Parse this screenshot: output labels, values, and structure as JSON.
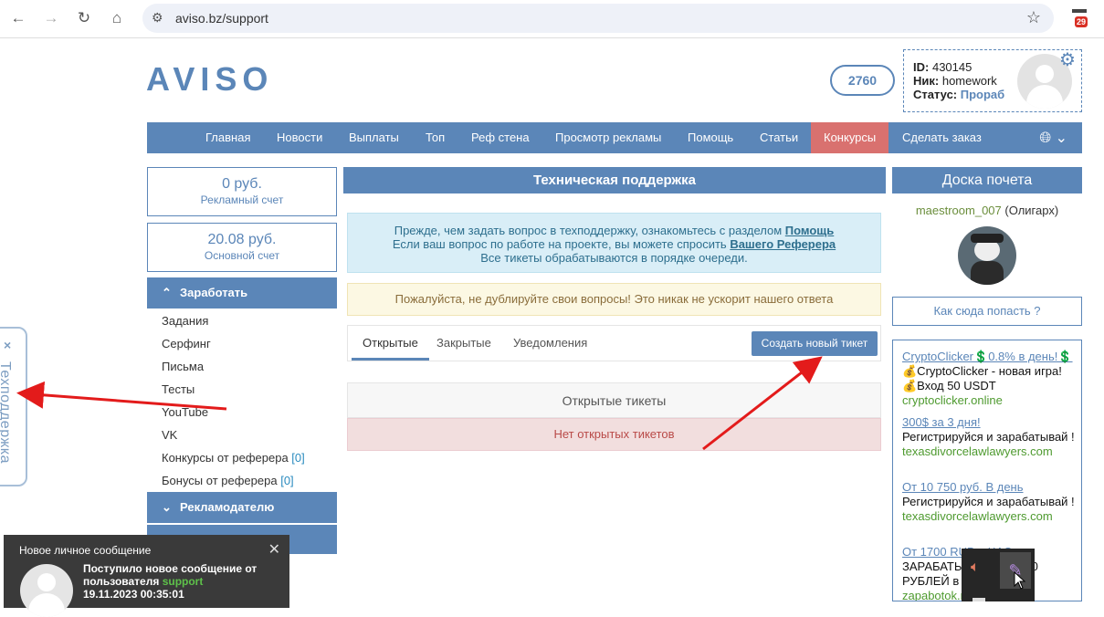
{
  "browser": {
    "url": "aviso.bz/support",
    "icons": [
      "back-icon",
      "forward-icon",
      "reload-icon",
      "home-icon",
      "site-settings-icon",
      "bookmark-star-icon",
      "calendar-extension-icon"
    ],
    "extension_badge": "29"
  },
  "header": {
    "logo": "AVISO",
    "balance_pill": "2760",
    "user": {
      "id_label": "ID:",
      "id_value": "430145",
      "nick_label": "Ник:",
      "nick_value": "homework",
      "status_label": "Статус:",
      "status_value": "Прораб"
    }
  },
  "nav": {
    "items": [
      "Главная",
      "Новости",
      "Выплаты",
      "Топ",
      "Реф стена",
      "Просмотр рекламы",
      "Помощь",
      "Статьи",
      "Конкурсы",
      "Сделать заказ"
    ],
    "highlight_color": "#d9716f"
  },
  "left": {
    "ad_balance": {
      "amount": "0 руб.",
      "label": "Рекламный счет"
    },
    "main_balance": {
      "amount": "20.08 руб.",
      "label": "Основной счет"
    },
    "earn_title": "Заработать",
    "earn_items": [
      {
        "label": "Задания",
        "count": ""
      },
      {
        "label": "Серфинг",
        "count": ""
      },
      {
        "label": "Письма",
        "count": ""
      },
      {
        "label": "Тесты",
        "count": ""
      },
      {
        "label": "YouTube",
        "count": ""
      },
      {
        "label": "VK",
        "count": ""
      },
      {
        "label": "Конкурсы от реферера",
        "count": "[0]"
      },
      {
        "label": "Бонусы от реферера",
        "count": "[0]"
      }
    ],
    "advertiser_title": "Рекламодателю"
  },
  "center": {
    "title": "Техническая поддержка",
    "info_line1_text": "Прежде, чем задать вопрос в техподдержку, ознакомьтесь с разделом ",
    "info_line1_link": "Помощь",
    "info_line2_text": "Если ваш вопрос по работе на проекте, вы можете спросить ",
    "info_line2_link": "Вашего Реферера",
    "info_line3": "Все тикеты обрабатываются в порядке очереди.",
    "warning": "Пожалуйста, не дублируйте свои вопросы! Это никак не ускорит нашего ответа",
    "tabs": [
      "Открытые",
      "Закрытые",
      "Уведомления"
    ],
    "new_ticket_button": "Создать новый тикет",
    "tickets_header": "Открытые тикеты",
    "tickets_empty": "Нет открытых тикетов"
  },
  "right": {
    "title": "Доска почета",
    "honor_user": "maestroom_007",
    "honor_rank": "(Олигарх)",
    "how_button": "Как сюда попасть ?",
    "ads": [
      {
        "title": "CryptoClicker💲0.8% в день!💲",
        "desc": "💰CryptoClicker - новая игра! 💰Вход 50 USDT",
        "url": "cryptoclicker.online"
      },
      {
        "title": "300$ за 3 дня!",
        "desc": "Регистрируйся и зарабатывай !",
        "url": "texasdivorcelawlawyers.com"
      },
      {
        "title": "От 10 750 руб. В день",
        "desc": "Регистрируйся и зарабатывай !",
        "url": "texasdivorcelawlawyers.com"
      },
      {
        "title": "От 1700 RUB в ЧАС",
        "desc": "ЗАРАБАТЫВАЙ ОТ 1700 РУБЛЕЙ в ЧАС",
        "url": "zapabotok.ru"
      }
    ]
  },
  "side_tab": {
    "close": "×",
    "label": "Техподдержка"
  },
  "notification": {
    "title": "Новое личное сообщение",
    "close": "✕",
    "line1": "Поступило новое сообщение от",
    "line2_prefix": "пользователя ",
    "sender": "support",
    "timestamp": "19.11.2023 00:35:01"
  },
  "colors": {
    "primary": "#5b86b8",
    "arrow": "#e31b1b"
  }
}
